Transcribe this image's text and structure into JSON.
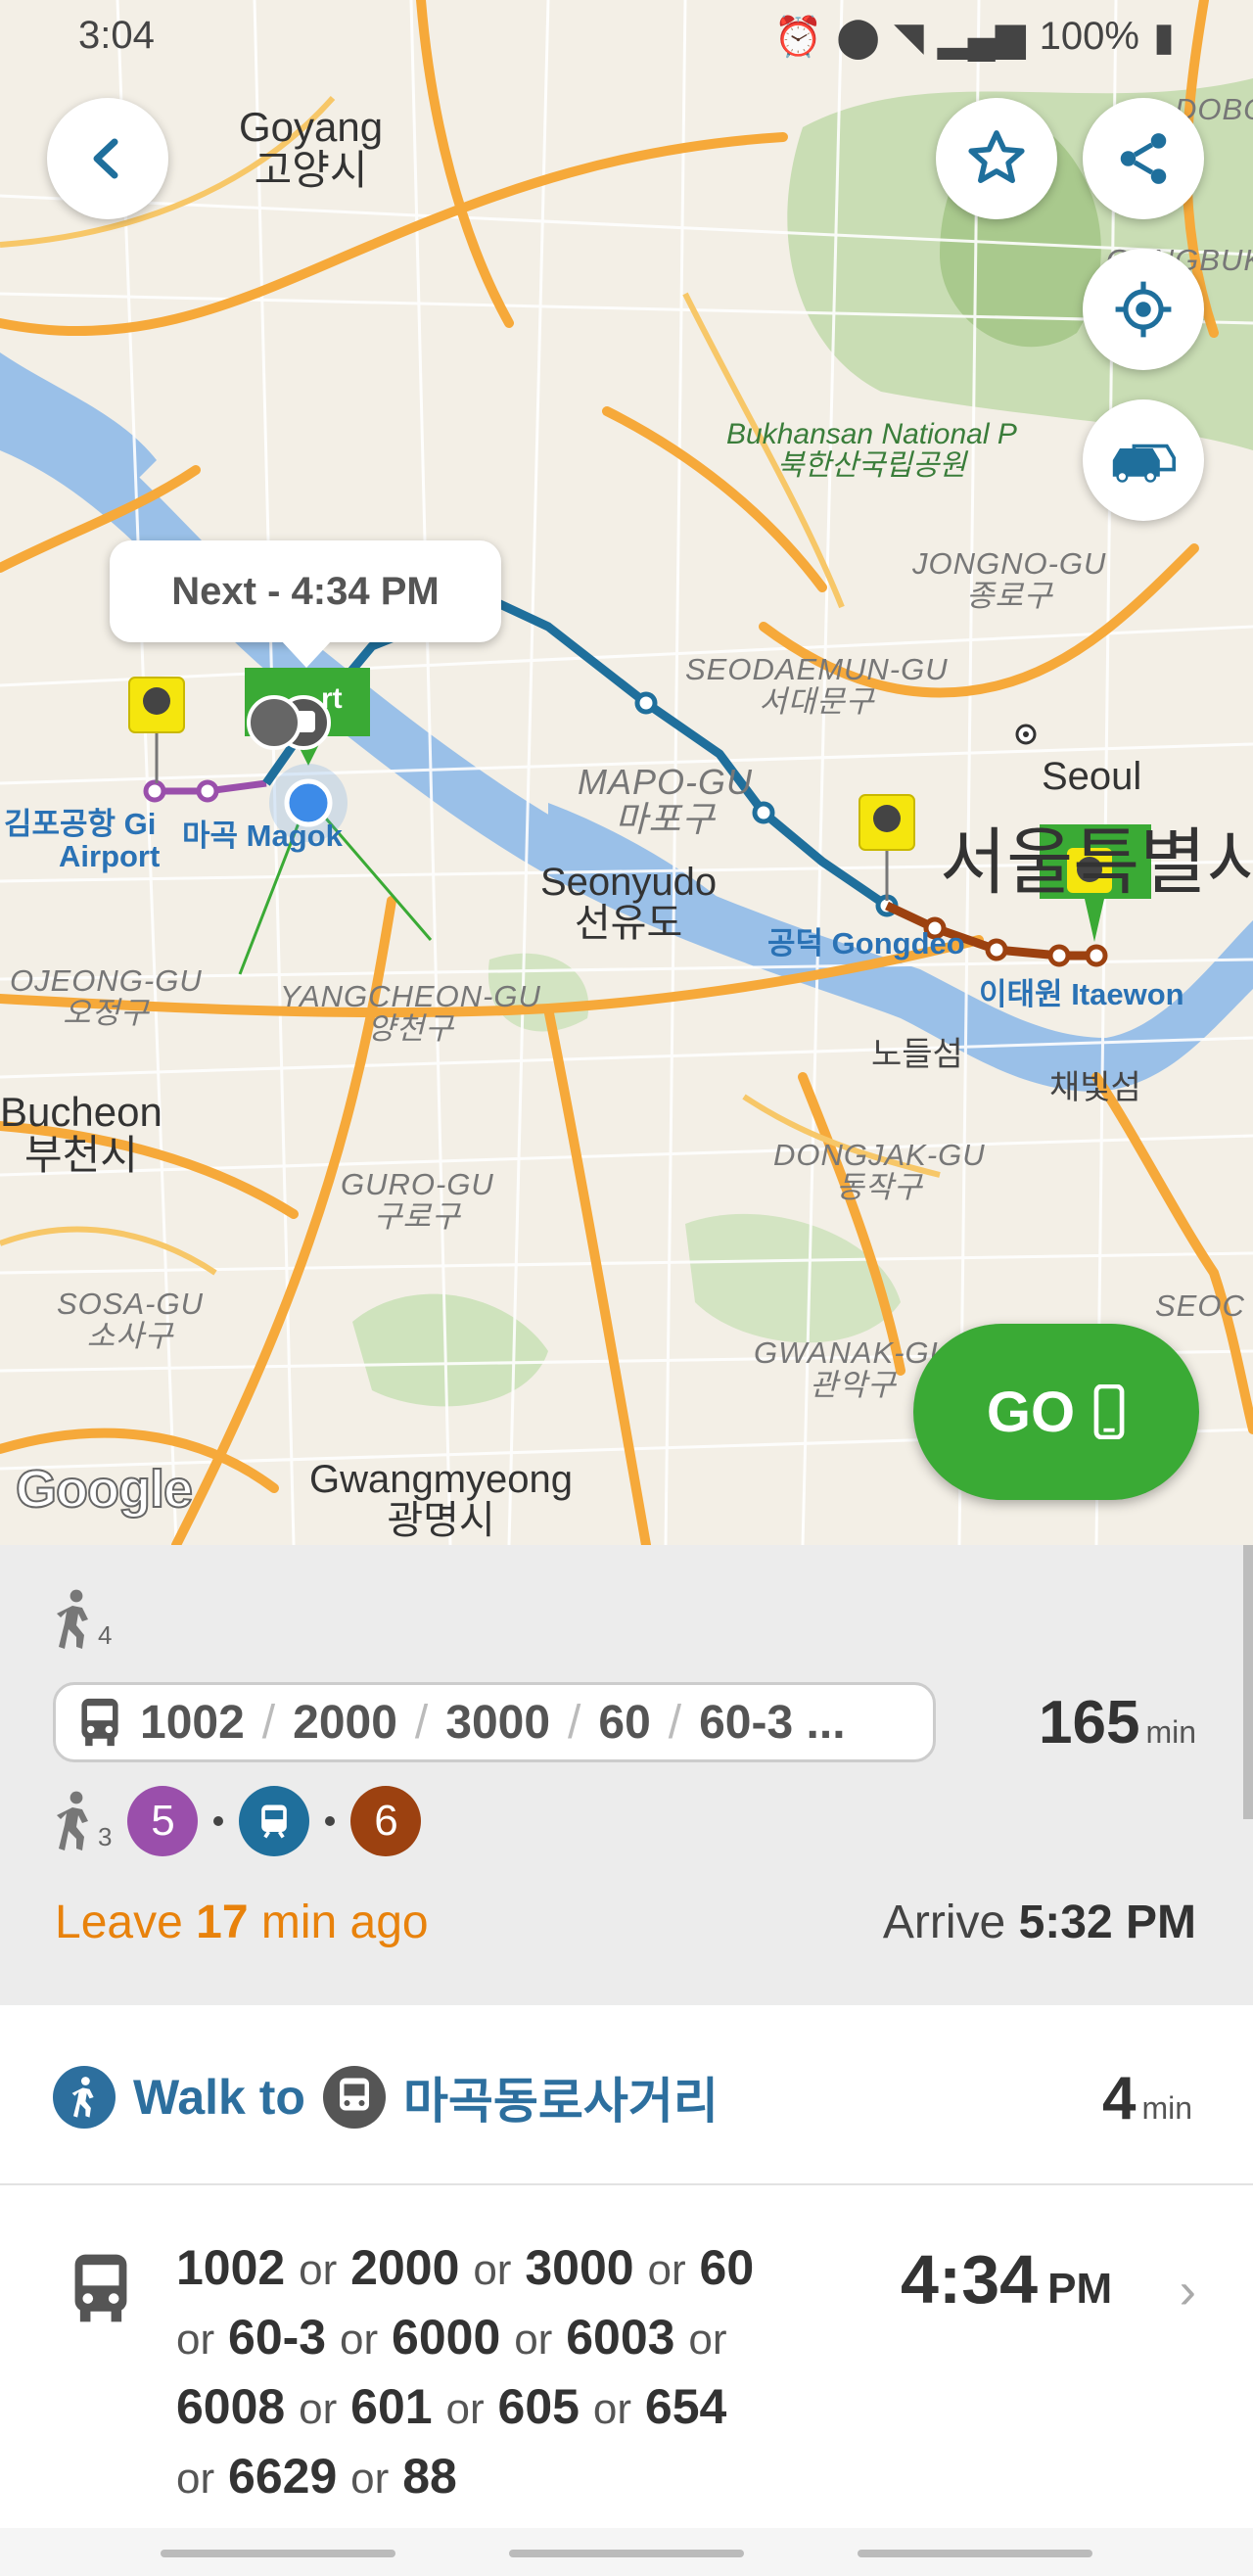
{
  "status_bar": {
    "time": "3:04",
    "battery": "100%"
  },
  "map": {
    "next_bubble": "Next - 4:34 PM",
    "labels": {
      "goyang": "Goyang",
      "goyang_ko": "고양시",
      "bukhansan": "Bukhansan National P",
      "bukhansan_ko": "북한산국립공원",
      "jongno": "JONGNO-GU",
      "jongno_ko": "종로구",
      "seodaemun": "SEODAEMUN-GU",
      "seodaemun_ko": "서대문구",
      "mapo": "MAPO-GU",
      "mapo_ko": "마포구",
      "seoul": "Seoul",
      "seoul_big": "서울특별시",
      "seonyudo": "Seonyudo",
      "seonyudo_ko": "선유도",
      "gimpo_ko": "김포공항",
      "gimpo": "Gi",
      "airport": "Airport",
      "magok_ko": "마곡",
      "magok": "Magok",
      "gongdeok_ko": "공덕",
      "gongdeok": "Gongdeo",
      "itaewon_ko": "이태원",
      "itaewon": "Itaewon",
      "ojeong": "OJEONG-GU",
      "ojeong_ko": "오정구",
      "yangcheon": "YANGCHEON-GU",
      "yangcheon_ko": "양천구",
      "nodeulseom": "노들섬",
      "chaebitseom": "채빛섬",
      "bucheon": "Bucheon",
      "bucheon_ko": "부천시",
      "dongjak": "DONGJAK-GU",
      "dongjak_ko": "동작구",
      "guro": "GURO-GU",
      "guro_ko": "구로구",
      "sosa": "SOSA-GU",
      "sosa_ko": "소사구",
      "gwanak": "GWANAK-GU",
      "gwanak_ko": "관악구",
      "gwangmyeong": "Gwangmyeong",
      "gwangmyeong_ko": "광명시",
      "gangbuk_partial": "GANGBUK-GU",
      "dobong_partial": "DOBO",
      "seocho_partial": "SEOC",
      "start_marker": "rt"
    },
    "go_button": "GO",
    "watermark": "Google"
  },
  "summary": {
    "walk_start_count": "4",
    "routes": [
      "1002",
      "2000",
      "3000",
      "60",
      "60-3 ..."
    ],
    "duration_value": "165",
    "duration_unit": "min",
    "walk_transfer_count": "3",
    "lines": [
      {
        "label": "5",
        "color": "#9a4fab"
      },
      {
        "label": "M",
        "color": "#1f6f9c"
      },
      {
        "label": "6",
        "color": "#9c4110"
      }
    ],
    "leave_prefix": "Leave",
    "leave_value": "17",
    "leave_suffix": "min ago",
    "arrive_label": "Arrive",
    "arrive_time": "5:32 PM"
  },
  "steps": {
    "walk": {
      "walk_to": "Walk to",
      "stop_name": "마곡동로사거리",
      "duration_value": "4",
      "duration_unit": "min"
    },
    "bus": {
      "routes": [
        "1002",
        "2000",
        "3000",
        "60",
        "60-3",
        "6000",
        "6003",
        "6008",
        "601",
        "605",
        "654",
        "6629",
        "88"
      ],
      "or": "or",
      "time": "4:34",
      "ampm": "PM"
    }
  },
  "colors": {
    "go_green": "#3aaa35",
    "leave_orange": "#e8820c",
    "walk_blue": "#2d6f9e",
    "route_blue": "#1f6f9c",
    "route_brown": "#9c4110",
    "route_purple": "#9a4fab"
  }
}
